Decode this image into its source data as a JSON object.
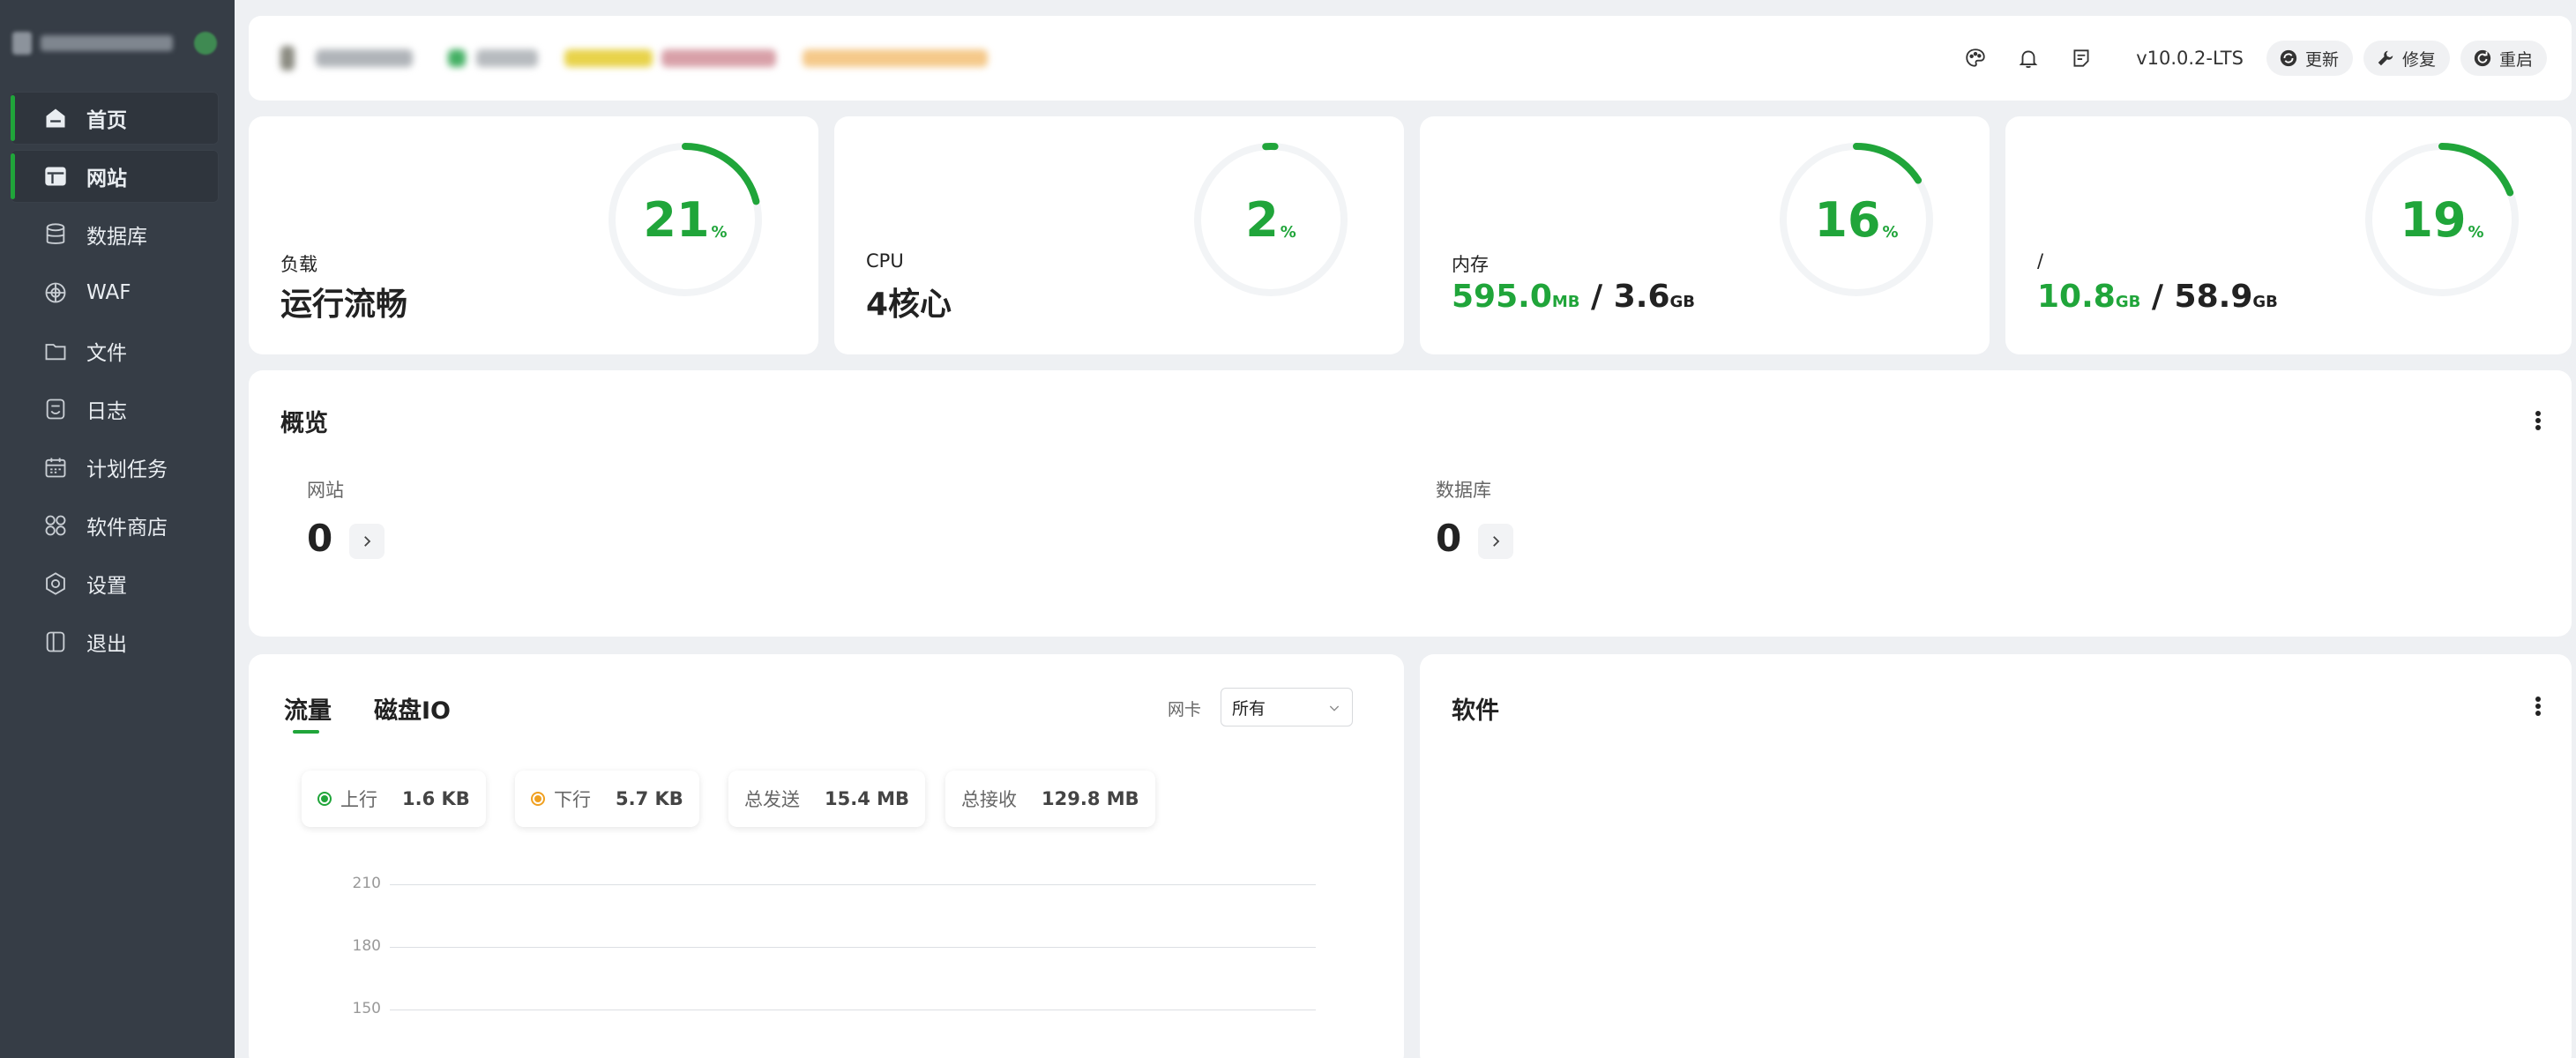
{
  "nav": [
    {
      "label": "首页",
      "icon": "home-icon",
      "active": true
    },
    {
      "label": "网站",
      "icon": "website-icon",
      "active": true
    },
    {
      "label": "数据库",
      "icon": "database-icon",
      "active": false
    },
    {
      "label": "WAF",
      "icon": "waf-shield-icon",
      "active": false
    },
    {
      "label": "文件",
      "icon": "folder-icon",
      "active": false
    },
    {
      "label": "日志",
      "icon": "log-icon",
      "active": false
    },
    {
      "label": "计划任务",
      "icon": "calendar-icon",
      "active": false
    },
    {
      "label": "软件商店",
      "icon": "app-store-icon",
      "active": false
    },
    {
      "label": "设置",
      "icon": "settings-icon",
      "active": false
    },
    {
      "label": "退出",
      "icon": "logout-icon",
      "active": false
    }
  ],
  "header": {
    "version": "v10.0.2-LTS",
    "buttons": {
      "update": "更新",
      "repair": "修复",
      "restart": "重启"
    }
  },
  "stats": {
    "load": {
      "percent": 21,
      "percent_sign": "%",
      "label": "负载",
      "value": "运行流畅"
    },
    "cpu": {
      "percent": 2,
      "percent_sign": "%",
      "label": "CPU",
      "value": "4核心"
    },
    "memory": {
      "percent": 16,
      "percent_sign": "%",
      "label": "内存",
      "used": "595.0",
      "used_unit": "MB",
      "sep": " / ",
      "total": "3.6",
      "total_unit": "GB"
    },
    "disk": {
      "percent": 19,
      "percent_sign": "%",
      "label": "/",
      "used": "10.8",
      "used_unit": "GB",
      "sep": " / ",
      "total": "58.9",
      "total_unit": "GB"
    }
  },
  "overview": {
    "title": "概览",
    "sites_label": "网站",
    "sites_count": "0",
    "db_label": "数据库",
    "db_count": "0"
  },
  "traffic": {
    "tab_traffic": "流量",
    "tab_disk": "磁盘IO",
    "nic_label": "网卡",
    "nic_value": "所有",
    "up_label": "上行",
    "up_value": "1.6 KB",
    "down_label": "下行",
    "down_value": "5.7 KB",
    "sent_label": "总发送",
    "sent_value": "15.4 MB",
    "recv_label": "总接收",
    "recv_value": "129.8 MB",
    "y_ticks": [
      "210",
      "180",
      "150"
    ]
  },
  "software": {
    "title": "软件"
  },
  "colors": {
    "accent": "#20a53a",
    "sidebar": "#363d46",
    "download": "#f0a020"
  }
}
